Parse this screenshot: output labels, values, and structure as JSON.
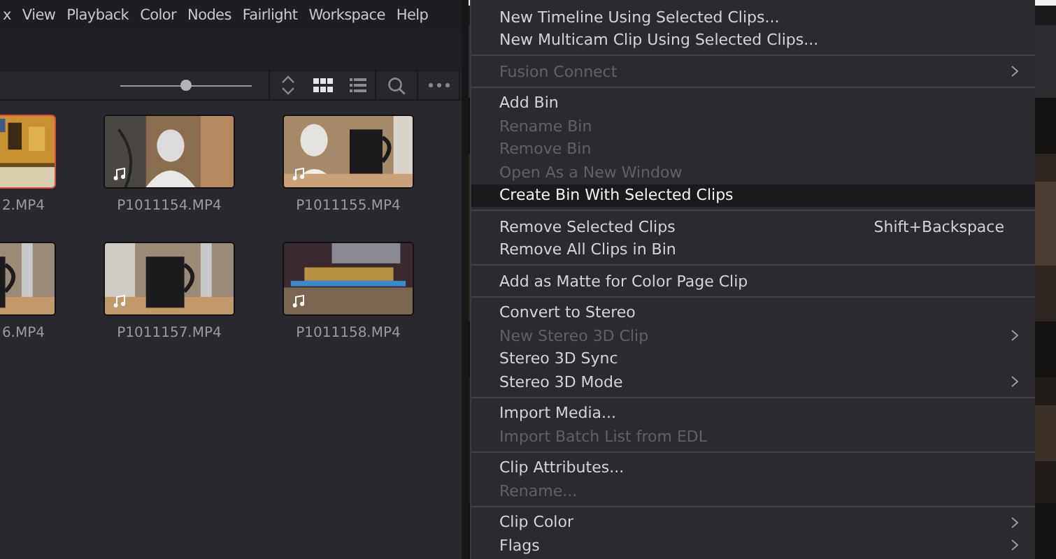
{
  "menubar": [
    {
      "label": "x"
    },
    {
      "label": "View"
    },
    {
      "label": "Playback"
    },
    {
      "label": "Color"
    },
    {
      "label": "Nodes"
    },
    {
      "label": "Fairlight"
    },
    {
      "label": "Workspace"
    },
    {
      "label": "Help"
    }
  ],
  "toolbar": {
    "zoom": {
      "level": 0.5
    },
    "view": [
      {
        "kind": "sort",
        "selected": false
      },
      {
        "kind": "grid",
        "selected": true
      },
      {
        "kind": "list",
        "selected": false
      }
    ]
  },
  "clips": [
    {
      "name": "2.MP4",
      "selected": true
    },
    {
      "name": "P1011154.MP4",
      "selected": false,
      "audio": true
    },
    {
      "name": "P1011155.MP4",
      "selected": false,
      "audio": true
    },
    {
      "name": "6.MP4",
      "selected": false
    },
    {
      "name": "P1011157.MP4",
      "selected": false,
      "audio": true
    },
    {
      "name": "P1011158.MP4",
      "selected": false,
      "audio": true
    }
  ],
  "context_menu": [
    [
      {
        "label": "New Timeline Using Selected Clips...",
        "disabled": false,
        "selected": false
      },
      {
        "label": "New Multicam Clip Using Selected Clips...",
        "disabled": false,
        "selected": false
      }
    ],
    [
      {
        "label": "Fusion Connect",
        "disabled": true,
        "selected": false,
        "submenu": true
      }
    ],
    [
      {
        "label": "Add Bin",
        "disabled": false,
        "selected": false
      },
      {
        "label": "Rename Bin",
        "disabled": true,
        "selected": false
      },
      {
        "label": "Remove Bin",
        "disabled": true,
        "selected": false
      },
      {
        "label": "Open As a New Window",
        "disabled": true,
        "selected": false
      },
      {
        "label": "Create Bin With Selected Clips",
        "disabled": false,
        "selected": true
      }
    ],
    [
      {
        "label": "Remove Selected Clips",
        "disabled": false,
        "selected": false,
        "shortcut": "Shift+Backspace"
      },
      {
        "label": "Remove All Clips in Bin",
        "disabled": false,
        "selected": false
      }
    ],
    [
      {
        "label": "Add as Matte for Color Page Clip",
        "disabled": false,
        "selected": false
      }
    ],
    [
      {
        "label": "Convert to Stereo",
        "disabled": false,
        "selected": false
      },
      {
        "label": "New Stereo 3D Clip",
        "disabled": true,
        "selected": false,
        "submenu": true
      },
      {
        "label": "Stereo 3D Sync",
        "disabled": false,
        "selected": false
      },
      {
        "label": "Stereo 3D Mode",
        "disabled": false,
        "selected": false,
        "submenu": true
      }
    ],
    [
      {
        "label": "Import Media...",
        "disabled": false,
        "selected": false
      },
      {
        "label": "Import Batch List from EDL",
        "disabled": true,
        "selected": false
      }
    ],
    [
      {
        "label": "Clip Attributes...",
        "disabled": false,
        "selected": false
      },
      {
        "label": "Rename...",
        "disabled": true,
        "selected": false
      }
    ],
    [
      {
        "label": "Clip Color",
        "disabled": false,
        "selected": false,
        "submenu": true
      },
      {
        "label": "Flags",
        "disabled": false,
        "selected": false,
        "submenu": true
      }
    ]
  ]
}
